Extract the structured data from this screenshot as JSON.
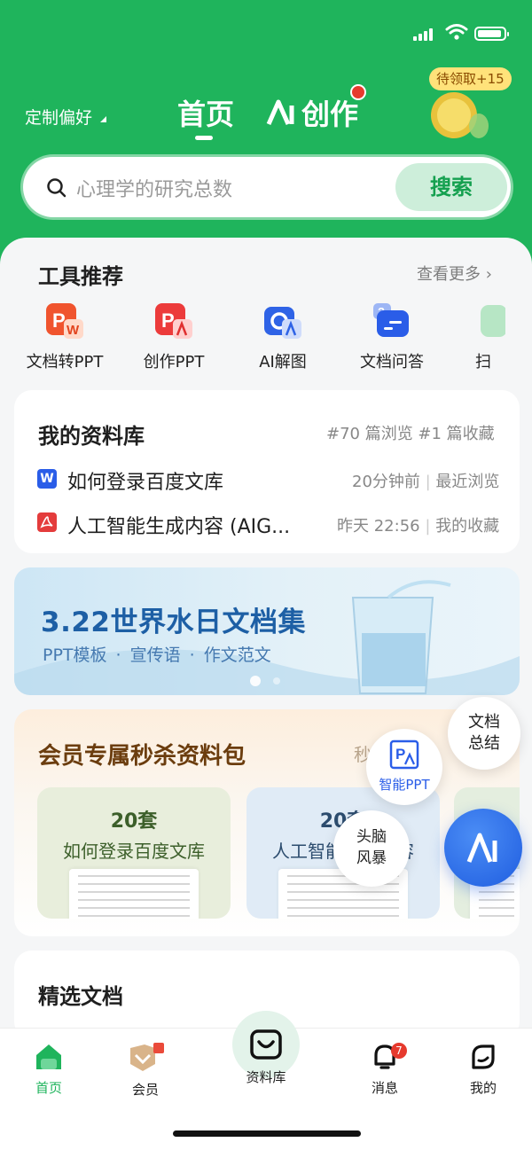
{
  "status_bar": {
    "time": ""
  },
  "header": {
    "preference": "定制偏好",
    "tab_home": "首页",
    "tab_create": "创作",
    "reward_badge": "待领取+15"
  },
  "search": {
    "placeholder": "心理学的研究总数",
    "button": "搜索"
  },
  "tools": {
    "title": "工具推荐",
    "more": "查看更多",
    "items": [
      {
        "label": "文档转PPT",
        "icon": "doc-to-ppt-icon"
      },
      {
        "label": "创作PPT",
        "icon": "create-ppt-icon"
      },
      {
        "label": "AI解图",
        "icon": "ai-image-icon"
      },
      {
        "label": "文档问答",
        "icon": "doc-qa-icon"
      },
      {
        "label": "扫",
        "icon": "scan-icon"
      }
    ]
  },
  "library": {
    "title": "我的资料库",
    "stats": "#70 篇浏览 #1 篇收藏",
    "items": [
      {
        "type": "W",
        "title": "如何登录百度文库",
        "time": "20分钟前",
        "tag": "最近浏览"
      },
      {
        "type": "pdf",
        "title": "人工智能生成内容 (AIG...",
        "time": "昨天   22:56",
        "tag": "我的收藏"
      }
    ]
  },
  "banner": {
    "title": "3.22世界水日文档集",
    "subtitle": "PPT模板  ·  宣传语  ·  作文范文"
  },
  "vip": {
    "title": "会员专属秒杀资料包",
    "side_text": "秒",
    "packs": [
      {
        "count": "20套",
        "name": "如何登录百度文库"
      },
      {
        "count": "20套",
        "name": "人工智能生成内容"
      }
    ]
  },
  "floating": {
    "summary": "文档总结",
    "smart_ppt": "智能PPT",
    "brainstorm": "头脑风暴"
  },
  "featured": {
    "title": "精选文档"
  },
  "nav": {
    "items": [
      {
        "label": "首页"
      },
      {
        "label": "会员"
      },
      {
        "label": "资料库"
      },
      {
        "label": "消息",
        "badge": "7"
      },
      {
        "label": "我的"
      }
    ]
  },
  "colors": {
    "brand_green": "#1fb45c",
    "accent_red": "#e63a2e",
    "blue": "#2a5de8"
  }
}
